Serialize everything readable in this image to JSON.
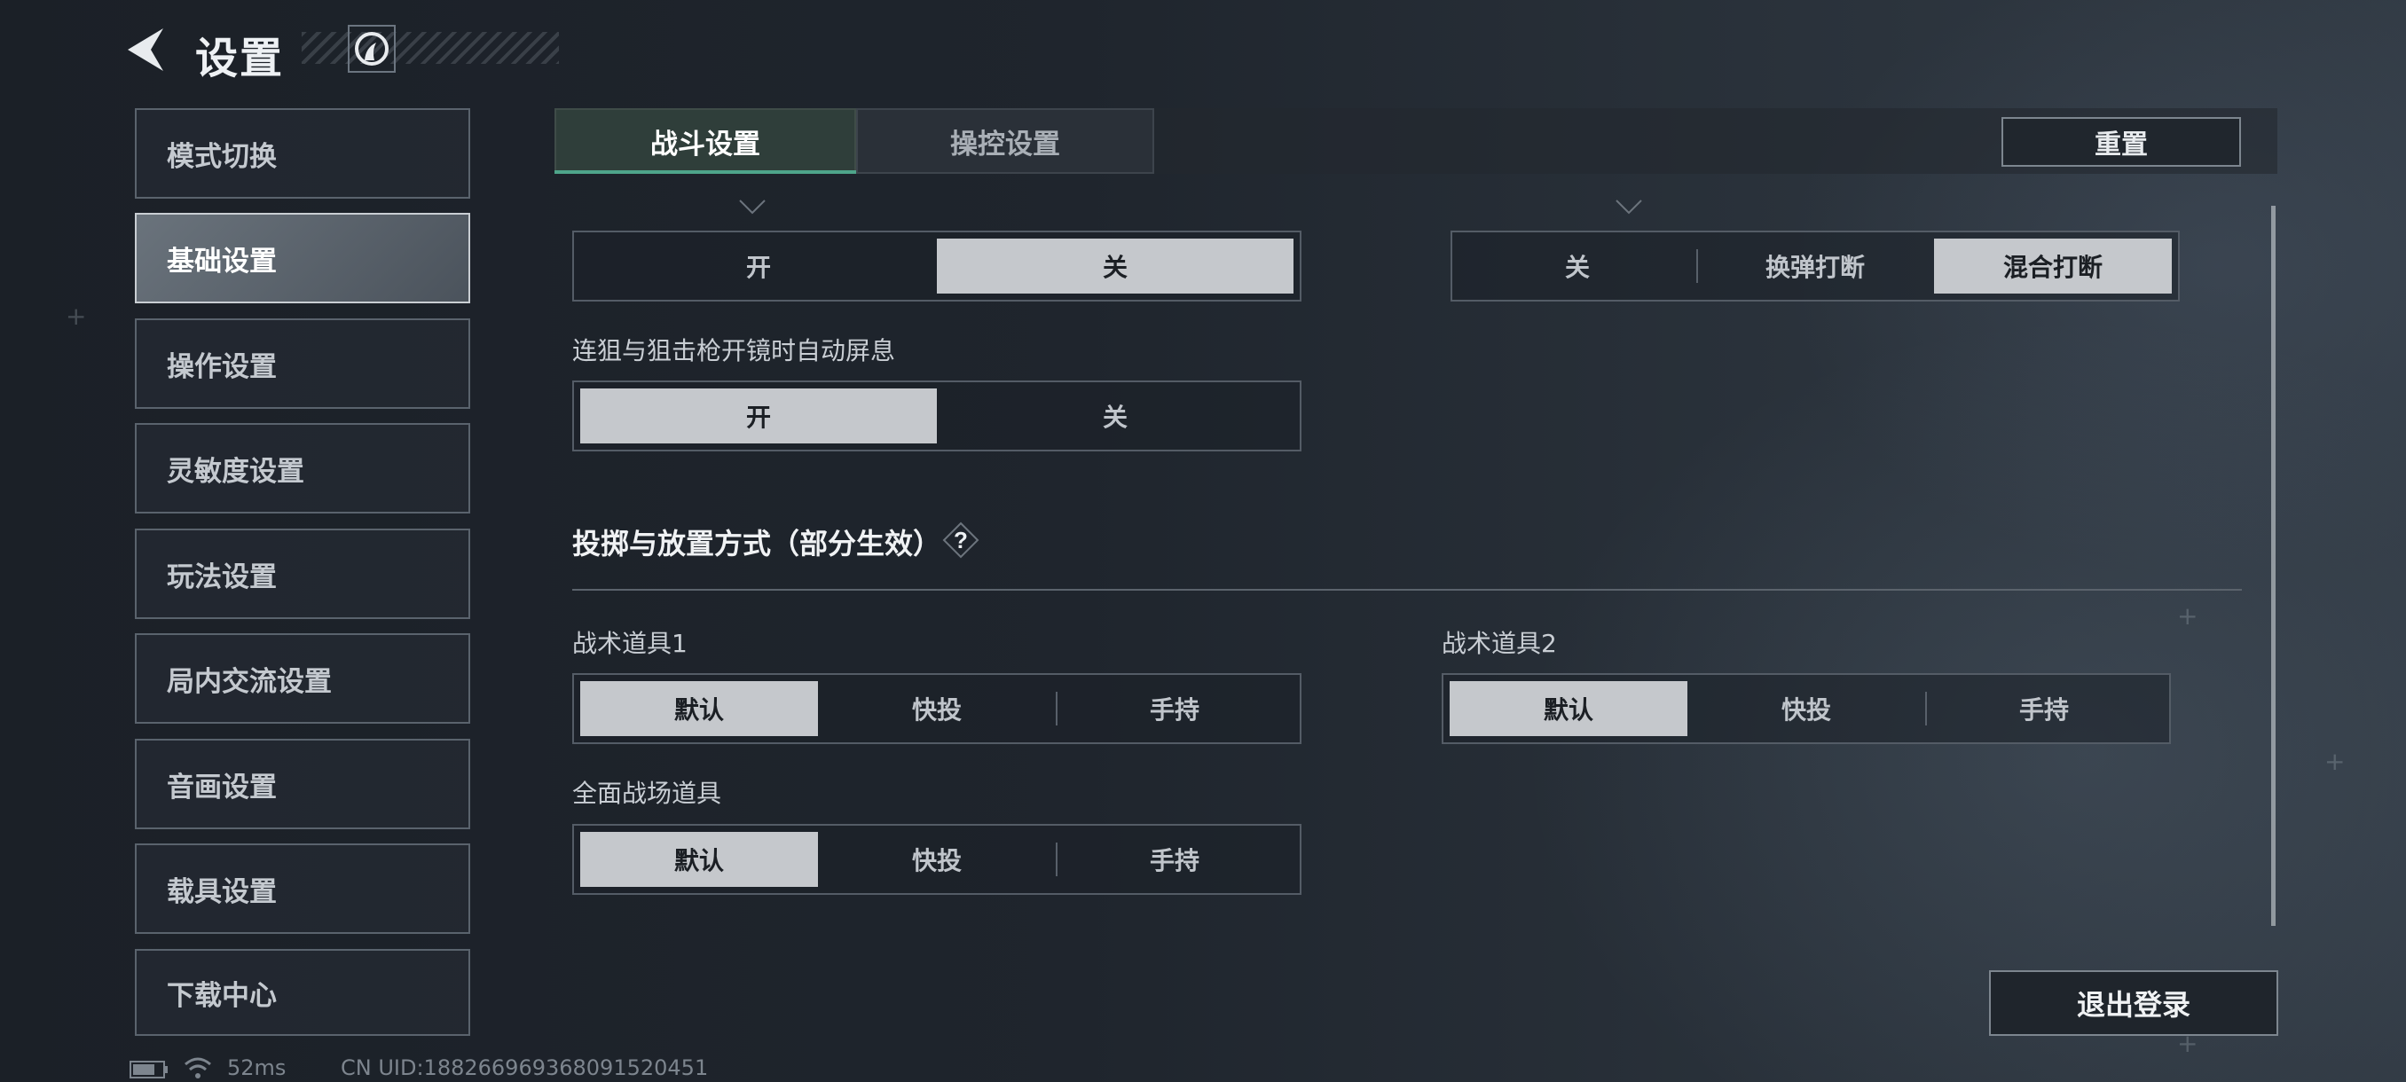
{
  "header": {
    "title": "设置"
  },
  "sidebar": {
    "items": [
      {
        "label": "模式切换",
        "active": false
      },
      {
        "label": "基础设置",
        "active": true
      },
      {
        "label": "操作设置",
        "active": false
      },
      {
        "label": "灵敏度设置",
        "active": false
      },
      {
        "label": "玩法设置",
        "active": false
      },
      {
        "label": "局内交流设置",
        "active": false
      },
      {
        "label": "音画设置",
        "active": false
      },
      {
        "label": "载具设置",
        "active": false
      },
      {
        "label": "下载中心",
        "active": false
      }
    ]
  },
  "tabs": [
    {
      "label": "战斗设置",
      "active": true
    },
    {
      "label": "操控设置",
      "active": false
    }
  ],
  "toolbar": {
    "reset_label": "重置"
  },
  "settings": {
    "partial_left": {
      "options": [
        "开",
        "关"
      ],
      "selected": "关"
    },
    "partial_right": {
      "options": [
        "关",
        "换弹打断",
        "混合打断"
      ],
      "selected": "混合打断"
    },
    "auto_hold_breath": {
      "label": "连狙与狙击枪开镜时自动屏息",
      "options": [
        "开",
        "关"
      ],
      "selected": "开"
    },
    "throw_section": {
      "title": "投掷与放置方式（部分生效）",
      "help": "?"
    },
    "tactical_1": {
      "label": "战术道具1",
      "options": [
        "默认",
        "快投",
        "手持"
      ],
      "selected": "默认"
    },
    "tactical_2": {
      "label": "战术道具2",
      "options": [
        "默认",
        "快投",
        "手持"
      ],
      "selected": "默认"
    },
    "battlefield_item": {
      "label": "全面战场道具",
      "options": [
        "默认",
        "快投",
        "手持"
      ],
      "selected": "默认"
    }
  },
  "footer": {
    "logout_label": "退出登录",
    "ping": "52ms",
    "uid": "CN UID:1882669693680915​20451"
  },
  "colors": {
    "accent": "#4ea58a",
    "selected_option": "#c5c8cc",
    "background": "#1f252d"
  }
}
